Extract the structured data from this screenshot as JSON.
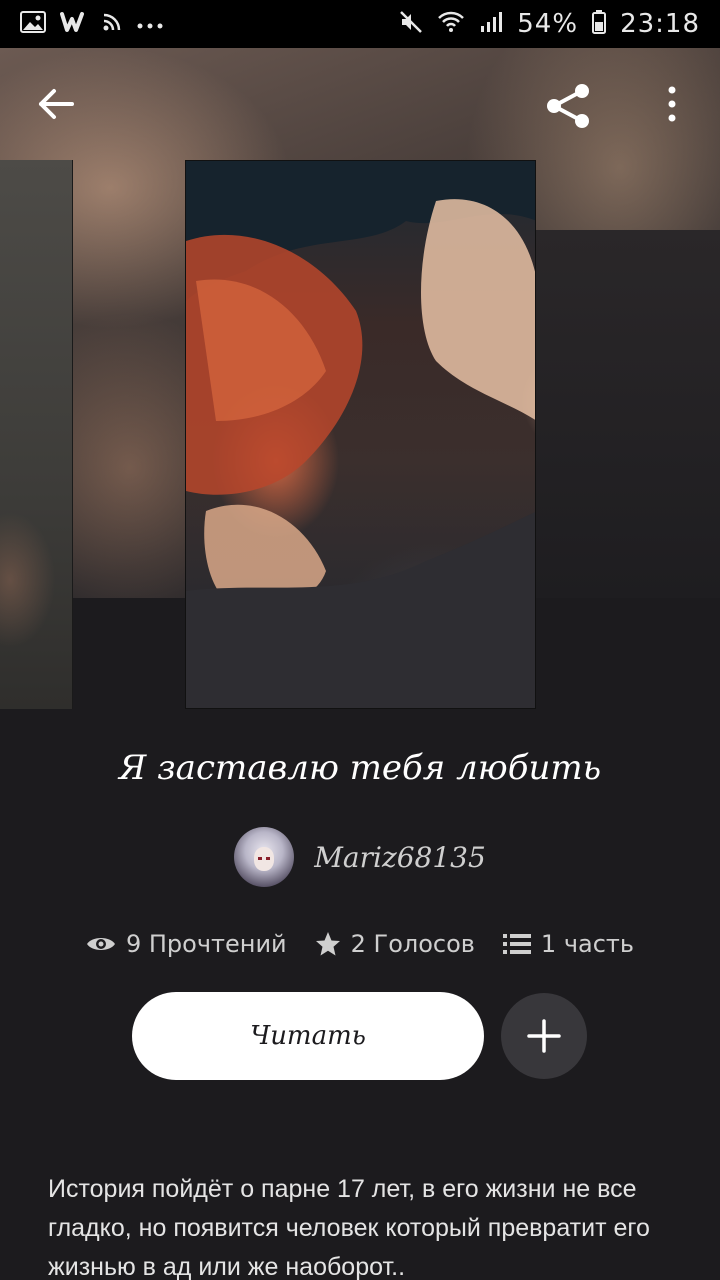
{
  "status_bar": {
    "left_icons": [
      "gallery-icon",
      "wattpad-w-icon",
      "rss-icon",
      "more-dots-icon"
    ],
    "battery": "54%",
    "time": "23:18"
  },
  "header": {
    "back_icon": "arrow-left-icon",
    "share_icon": "share-icon",
    "more_icon": "vertical-dots-icon"
  },
  "story": {
    "title": "Я заставлю тебя любить",
    "author": "Mariz68135",
    "stats": {
      "reads": "9 Прочтений",
      "votes": "2 Голосов",
      "parts": "1 часть"
    },
    "read_button": "Читать",
    "description": "История пойдёт о парне 17 лет, в его жизни не все гладко, но появится человек который превратит его жизнью в ад или же наоборот.."
  }
}
